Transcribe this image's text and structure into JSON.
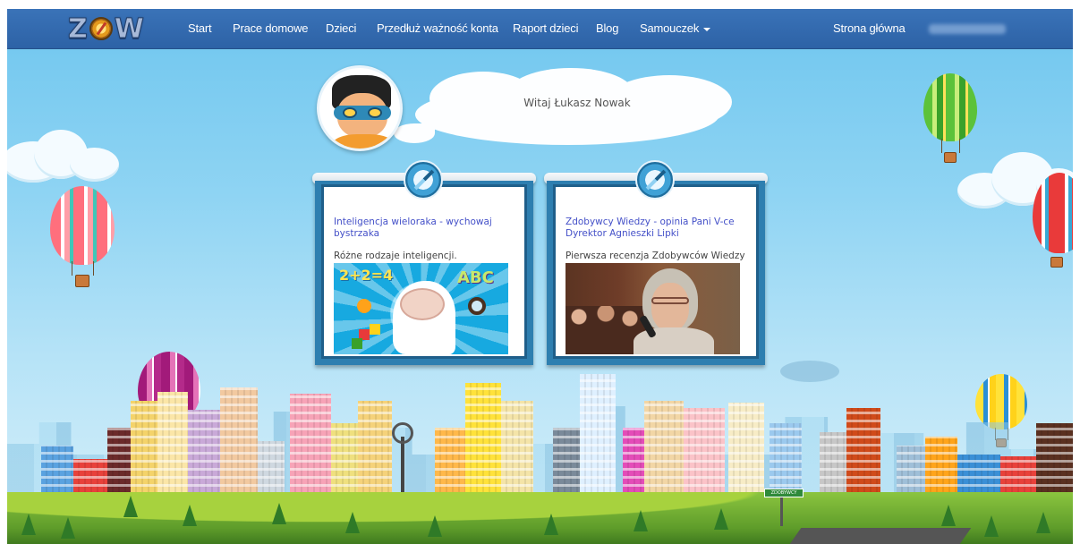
{
  "nav": {
    "logo": "ZOW",
    "items": [
      "Start",
      "Prace domowe",
      "Dzieci",
      "Przedłuż ważność konta",
      "Raport dzieci",
      "Blog",
      "Samouczek"
    ],
    "right_link": "Strona główna"
  },
  "greeting": "Witaj Łukasz Nowak",
  "cards": [
    {
      "title": "Inteligencja wieloraka - wychowaj bystrzaka",
      "description": "Różne rodzaje inteligencji.",
      "image_text_1": "2+2=4",
      "image_text_2": "ABC"
    },
    {
      "title": "Zdobywcy Wiedzy - opinia Pani V-ce Dyrektor Agnieszki Lipki",
      "description": "Pierwsza recenzja Zdobywców Wiedzy"
    }
  ],
  "sign": "ZDOBYWCY WIEDZY",
  "colors": {
    "navbar": "#3a73b8",
    "link": "#4450c8",
    "card_border": "#2e7fb0",
    "sky": "#8fd4f3"
  }
}
